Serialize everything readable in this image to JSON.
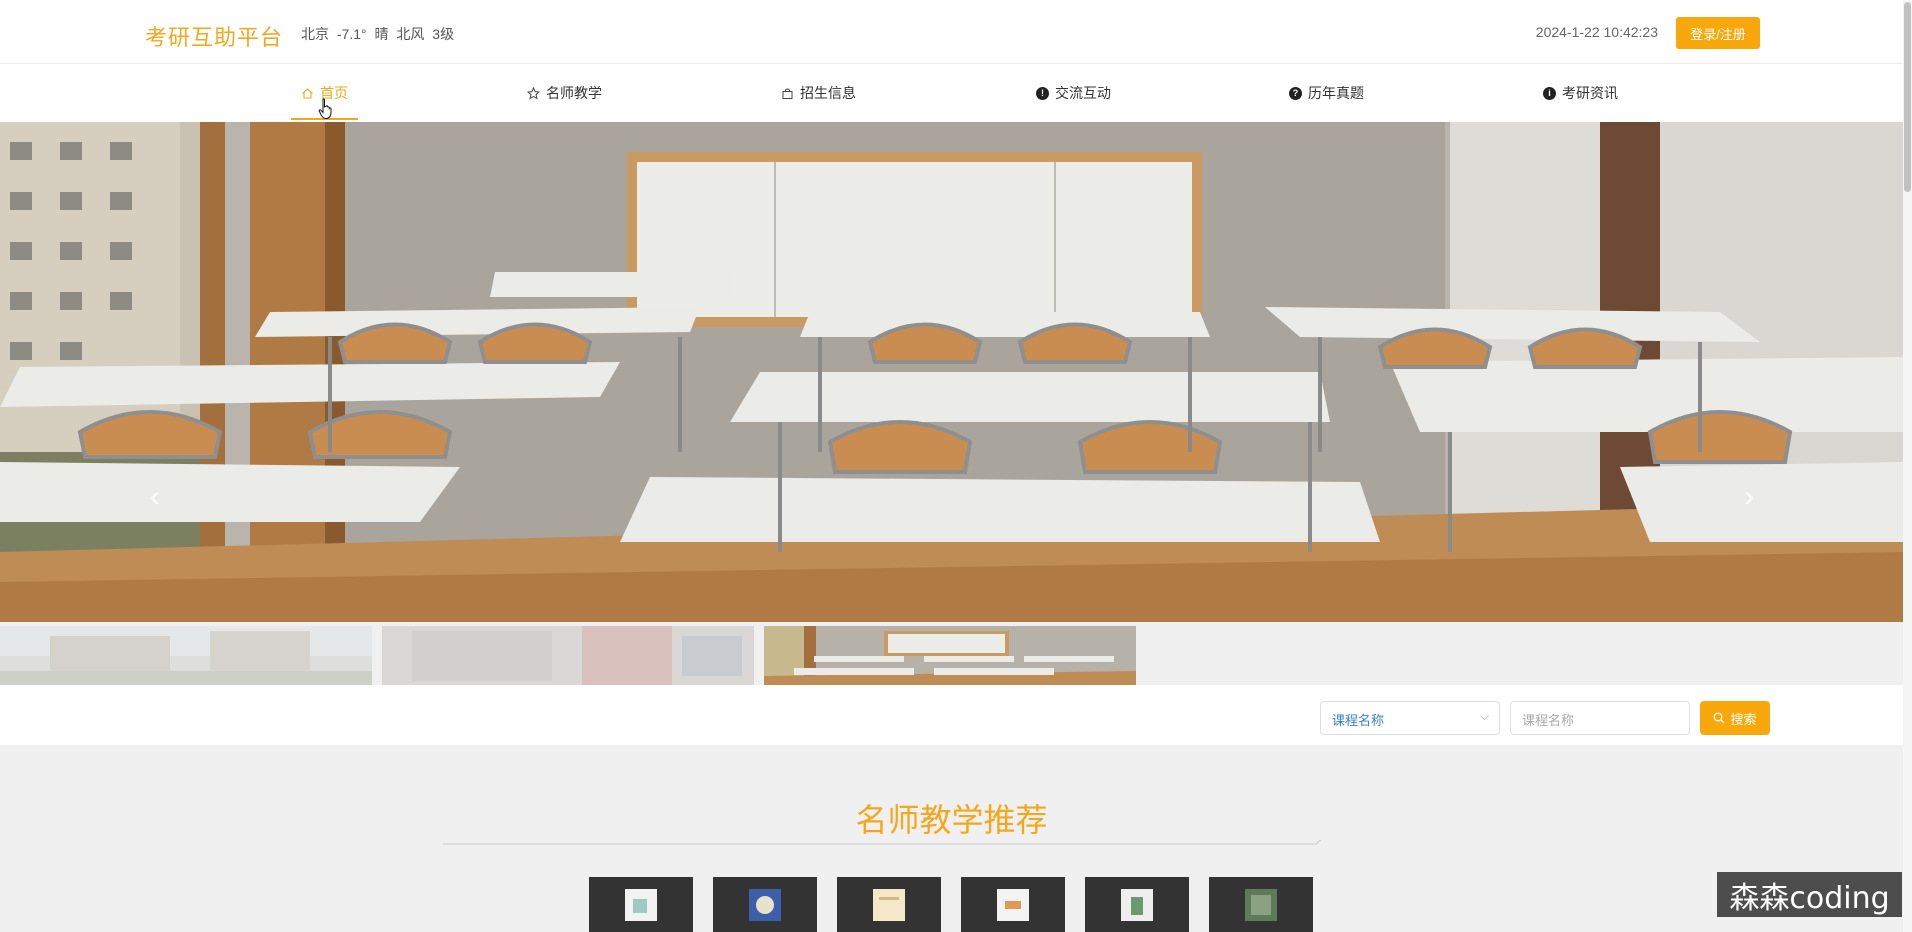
{
  "header": {
    "logo": "考研互助平台",
    "weather": "北京 -7.1° 晴 北风 3级",
    "datetime": "2024-1-22 10:42:23",
    "login_label": "登录/注册"
  },
  "nav": {
    "active_index": 0,
    "items": [
      {
        "label": "首页",
        "icon": "home-icon"
      },
      {
        "label": "名师教学",
        "icon": "star-icon"
      },
      {
        "label": "招生信息",
        "icon": "bag-icon"
      },
      {
        "label": "交流互动",
        "icon": "info-icon"
      },
      {
        "label": "历年真题",
        "icon": "question-icon"
      },
      {
        "label": "考研资讯",
        "icon": "info-icon"
      }
    ]
  },
  "carousel": {
    "prev_icon": "chevron-left-icon",
    "next_icon": "chevron-right-icon",
    "slide_count": 3,
    "active_slide": 3
  },
  "search": {
    "select_value": "课程名称",
    "input_placeholder": "课程名称",
    "button_label": "搜索"
  },
  "section": {
    "title": "名师教学推荐",
    "card_count": 6
  },
  "watermark": "森森coding",
  "colors": {
    "accent": "#f2a81d",
    "button": "#f9a80c"
  }
}
